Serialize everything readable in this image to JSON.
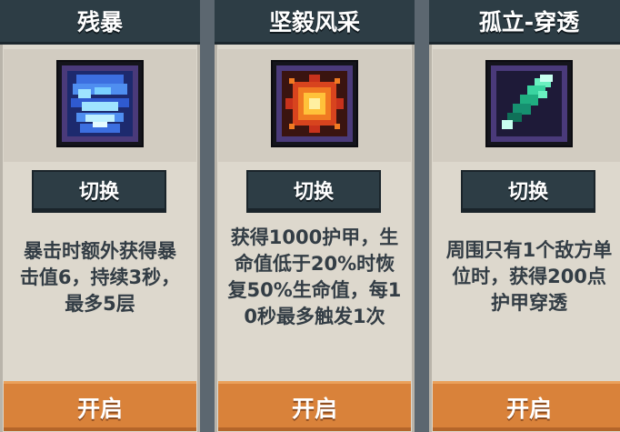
{
  "cards": [
    {
      "title": "残暴",
      "icon": "blue-crystal-icon",
      "switch_label": "切换",
      "desc_lines": [
        "暴击时额外获得暴",
        "击值6，持续3秒，",
        "最多5层"
      ],
      "open_label": "开启"
    },
    {
      "title": "坚毅风采",
      "icon": "fire-burst-icon",
      "switch_label": "切换",
      "desc_lines": [
        "获得1000护甲，生",
        "命值低于20%时恢",
        "复50%生命值，每1",
        "0秒最多触发1次"
      ],
      "open_label": "开启"
    },
    {
      "title": "孤立-穿透",
      "icon": "green-arrow-icon",
      "switch_label": "切换",
      "desc_lines": [
        "周围只有1个敌方单",
        "位时，获得200点",
        "护甲穿透"
      ],
      "open_label": "开启"
    }
  ],
  "colors": {
    "header": "#2d3d45",
    "card_bg": "#ddd8cd",
    "open_button": "#d9823a",
    "text": "#333d45"
  }
}
